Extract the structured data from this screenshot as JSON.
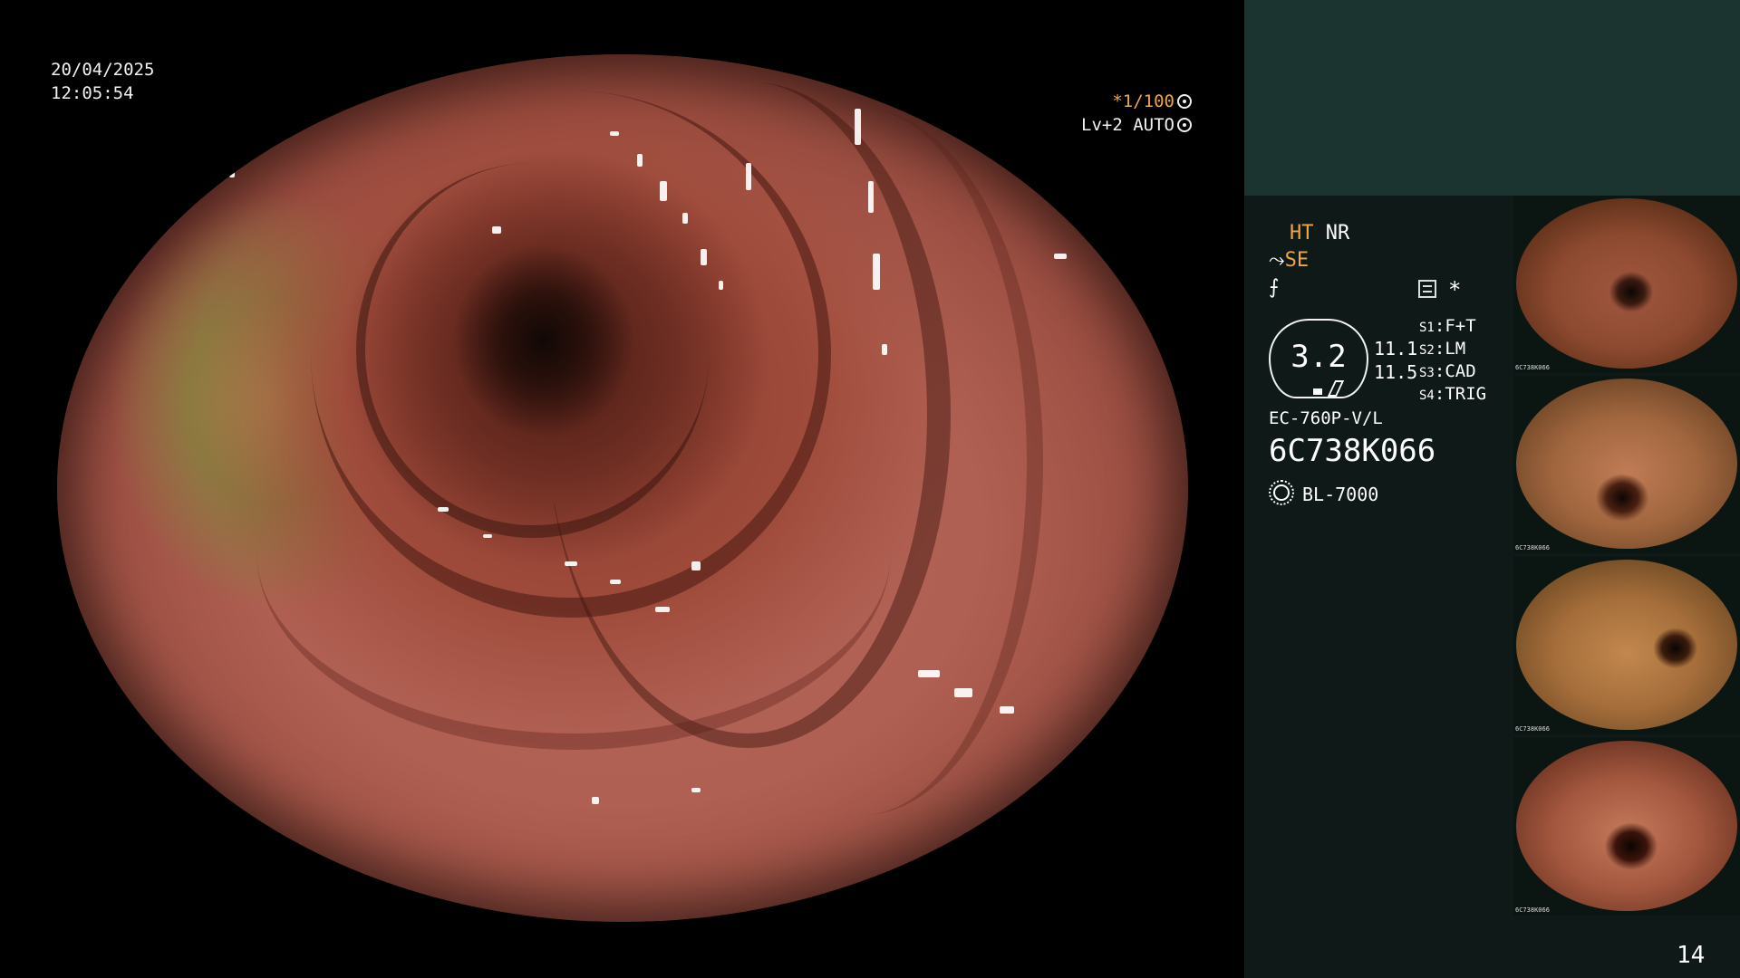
{
  "overlay": {
    "date": "20/04/2025",
    "time": "12:05:54",
    "shutter": "*1/100",
    "iris_level": "Lv+2 AUTO"
  },
  "panel": {
    "ht_label": "HT",
    "nr_label": "NR",
    "se_label": "SE",
    "curve_symbol": "⨍",
    "star_symbol": "*",
    "zoom": "3.2",
    "zoom_values": [
      "11.1",
      "11.5"
    ],
    "switches": [
      {
        "key": "S1",
        "value": "F+T"
      },
      {
        "key": "S2",
        "value": "LM"
      },
      {
        "key": "S3",
        "value": "CAD"
      },
      {
        "key": "S4",
        "value": "TRIG"
      }
    ],
    "scope_model": "EC-760P-V/L",
    "serial": "6C738K066",
    "light_source": "BL-7000",
    "image_counter": "14"
  },
  "thumbnails": [
    {
      "id": "6C738K066"
    },
    {
      "id": "6C738K066"
    },
    {
      "id": "6C738K066"
    },
    {
      "id": "6C738K066"
    }
  ],
  "colors": {
    "panel_top": "#1b3430",
    "panel_body": "#0f1a18",
    "accent_orange": "#f0a640"
  },
  "icons": [
    "iris-icon",
    "auto-iris-icon",
    "memo-icon",
    "light-source-icon"
  ]
}
